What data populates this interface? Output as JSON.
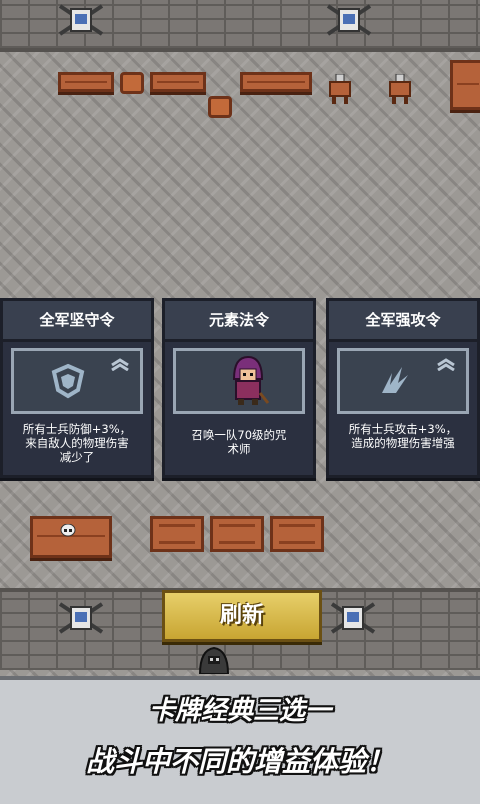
{
  "cards": [
    {
      "title": "全军坚守令",
      "desc": "所有士兵防御+3%，\n来自敌人的物理伤害\n减少了",
      "icon": "shield-icon"
    },
    {
      "title": "元素法令",
      "desc": "召唤一队70级的咒\n术师",
      "icon": "mage-portrait"
    },
    {
      "title": "全军强攻令",
      "desc": "所有士兵攻击+3%，\n造成的物理伤害增强",
      "icon": "claw-slash-icon"
    }
  ],
  "refresh_label": "刷新",
  "banner": {
    "line1": "卡牌经典三选一",
    "line2": "战斗中不同的增益体验！"
  },
  "colors": {
    "card_bg": "#2b3040",
    "button_gold": "#d8b84a",
    "banner_bg": "#c9ccd0"
  }
}
